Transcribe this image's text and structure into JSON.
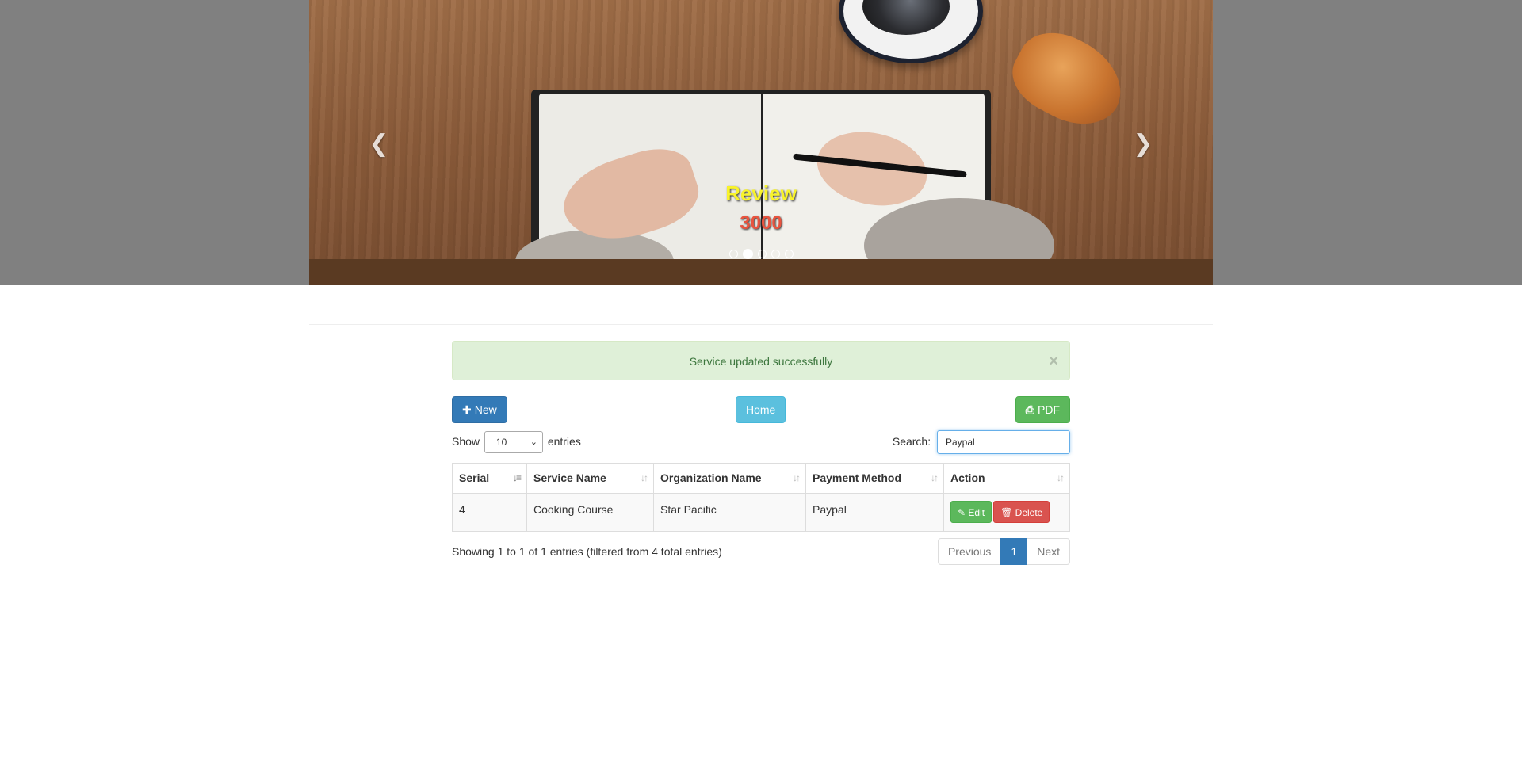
{
  "carousel": {
    "caption_title": "Review",
    "caption_value": "3000",
    "prev_icon": "chevron-left-icon",
    "next_icon": "chevron-right-icon",
    "slide_count": 5,
    "active_slide": 2,
    "image_subject": "notebook-writing-desk"
  },
  "alert": {
    "message": "Service updated successfully",
    "close": "×",
    "color": "#dff0d8"
  },
  "toolbar": {
    "new_label": "New",
    "new_icon": "plus-icon",
    "home_label": "Home",
    "pdf_label": "PDF",
    "pdf_icon": "print-icon"
  },
  "length": {
    "show_label": "Show",
    "selected": "10",
    "entries_label": "entries"
  },
  "search": {
    "label": "Search:",
    "value": "Paypal"
  },
  "table": {
    "headers": [
      "Serial",
      "Service Name",
      "Organization Name",
      "Payment Method",
      "Action"
    ],
    "rows": [
      {
        "serial": "4",
        "service": "Cooking Course",
        "organization": "Star Pacific",
        "payment": "Paypal",
        "edit_label": "Edit",
        "delete_label": "Delete"
      }
    ]
  },
  "info": "Showing 1 to 1 of 1 entries (filtered from 4 total entries)",
  "pagination": {
    "previous": "Previous",
    "current": "1",
    "next": "Next"
  },
  "colors": {
    "primary": "#337ab7",
    "info": "#5bc0de",
    "success": "#5cb85c",
    "danger": "#d9534f"
  }
}
